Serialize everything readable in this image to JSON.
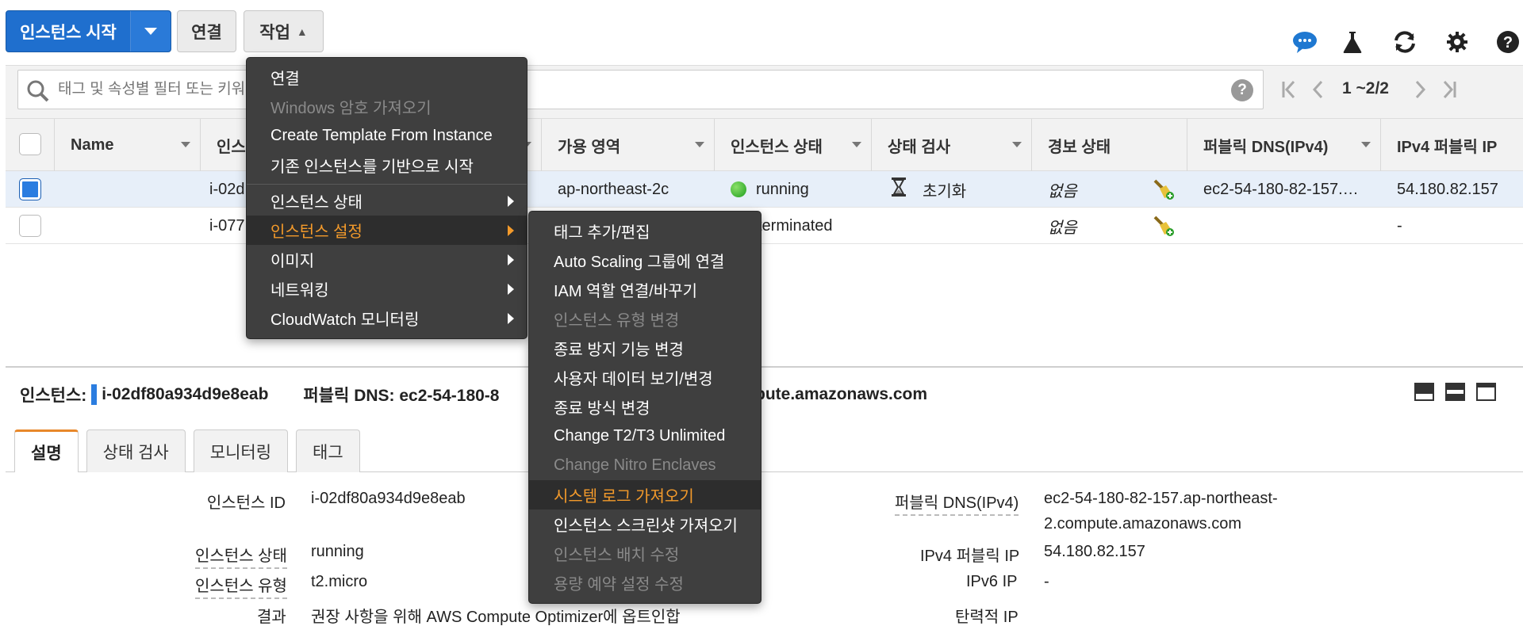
{
  "toolbar": {
    "launch_label": "인스턴스 시작",
    "connect_label": "연결",
    "actions_label": "작업"
  },
  "search": {
    "placeholder": "태그 및 속성별 필터 또는 키워드별 검색"
  },
  "pagination": {
    "range": "1 ~2/2"
  },
  "table": {
    "columns": [
      "Name",
      "인스턴스 ID",
      "가용 영역",
      "인스턴스 상태",
      "상태 검사",
      "경보 상태",
      "퍼블릭 DNS(IPv4)",
      "IPv4 퍼블릭 IP"
    ],
    "rows": [
      {
        "name": "",
        "instance_id": "i-02d",
        "az": "ap-northeast-2c",
        "state": "running",
        "status_check": "초기화",
        "alarm": "없음",
        "public_dns": "ec2-54-180-82-157.…",
        "public_ip": "54.180.82.157",
        "selected": true
      },
      {
        "name": "",
        "instance_id": "i-077",
        "az": "",
        "state": "terminated",
        "status_check": "",
        "alarm": "없음",
        "public_dns": "",
        "public_ip": "-",
        "selected": false
      }
    ]
  },
  "detail": {
    "instance_label": "인스턴스:",
    "instance_id": "i-02df80a934d9e8eab",
    "dns_label": "퍼블릭 DNS: ec2-54-180-8",
    "dns_tail": "pute.amazonaws.com",
    "tabs": [
      "설명",
      "상태 검사",
      "모니터링",
      "태그"
    ],
    "fields_left": [
      {
        "label": "인스턴스 ID",
        "value": "i-02df80a934d9e8eab"
      },
      {
        "label": "인스턴스 상태",
        "value": "running"
      },
      {
        "label": "인스턴스 유형",
        "value": "t2.micro"
      },
      {
        "label": "결과",
        "value": "권장 사항을 위해 AWS Compute Optimizer에 옵트인합"
      }
    ],
    "fields_right": [
      {
        "label": "퍼블릭 DNS(IPv4)",
        "value": "ec2-54-180-82-157.ap-northeast-",
        "value2": "2.compute.amazonaws.com"
      },
      {
        "label": "IPv4 퍼블릭 IP",
        "value": "54.180.82.157"
      },
      {
        "label": "IPv6 IP",
        "value": "-"
      },
      {
        "label": "탄력적 IP",
        "value": ""
      }
    ]
  },
  "actions_menu": {
    "items": [
      {
        "label": "연결",
        "disabled": false
      },
      {
        "label": "Windows 암호 가져오기",
        "disabled": true
      },
      {
        "label": "Create Template From Instance",
        "disabled": false
      },
      {
        "label": "기존 인스턴스를 기반으로 시작",
        "disabled": false
      },
      {
        "label": "인스턴스 상태",
        "disabled": false,
        "submenu": true
      },
      {
        "label": "인스턴스 설정",
        "disabled": false,
        "submenu": true,
        "highlighted": true
      },
      {
        "label": "이미지",
        "disabled": false,
        "submenu": true
      },
      {
        "label": "네트워킹",
        "disabled": false,
        "submenu": true
      },
      {
        "label": "CloudWatch 모니터링",
        "disabled": false,
        "submenu": true
      }
    ]
  },
  "settings_submenu": {
    "items": [
      {
        "label": "태그 추가/편집",
        "disabled": false
      },
      {
        "label": "Auto Scaling 그룹에 연결",
        "disabled": false
      },
      {
        "label": "IAM 역할 연결/바꾸기",
        "disabled": false
      },
      {
        "label": "인스턴스 유형 변경",
        "disabled": true
      },
      {
        "label": "종료 방지 기능 변경",
        "disabled": false
      },
      {
        "label": "사용자 데이터 보기/변경",
        "disabled": false
      },
      {
        "label": "종료 방식 변경",
        "disabled": false
      },
      {
        "label": "Change T2/T3 Unlimited",
        "disabled": false
      },
      {
        "label": "Change Nitro Enclaves",
        "disabled": true
      },
      {
        "label": "시스템 로그 가져오기",
        "disabled": false,
        "highlighted": true
      },
      {
        "label": "인스턴스 스크린샷 가져오기",
        "disabled": false
      },
      {
        "label": "인스턴스 배치 수정",
        "disabled": true
      },
      {
        "label": "용량 예약 설정 수정",
        "disabled": true
      }
    ]
  },
  "colors": {
    "primary": "#1f6fce",
    "menu_bg": "#3f3f3f",
    "menu_highlight_text": "#f39a2b",
    "tab_accent": "#e8882a"
  },
  "icons": [
    "chat-icon",
    "flask-icon",
    "refresh-icon",
    "gear-icon",
    "help-icon",
    "search-icon",
    "hourglass-icon",
    "broom-icon"
  ]
}
